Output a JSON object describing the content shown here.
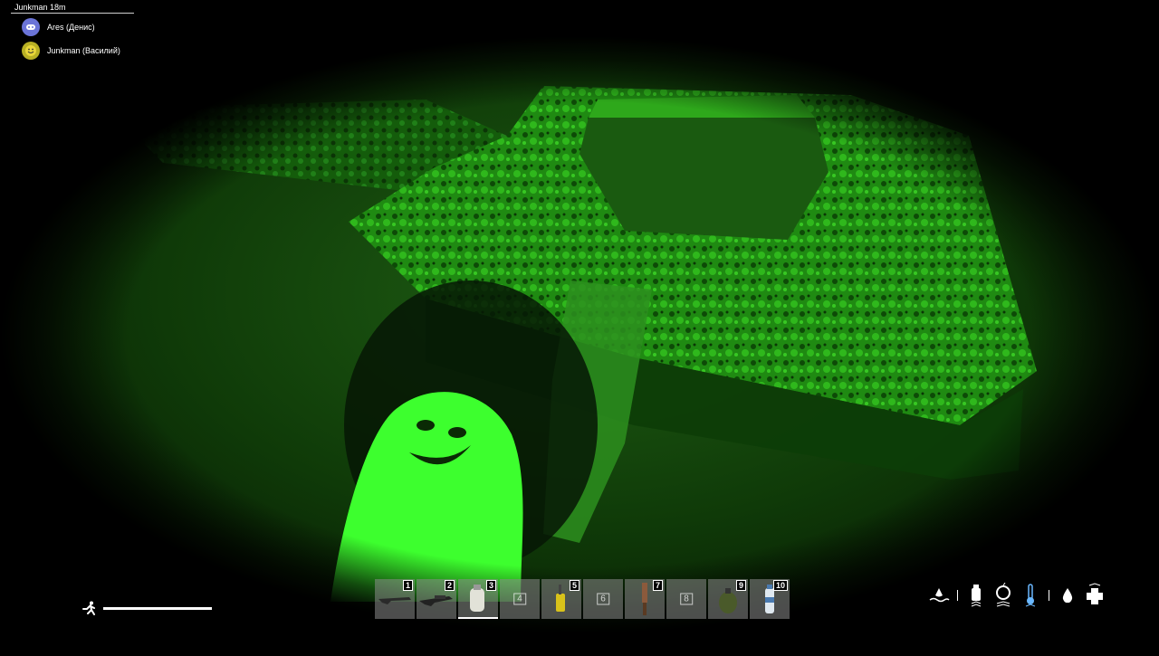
{
  "overlay": {
    "title": "Junkman 18m",
    "voice_users": [
      {
        "name": "Ares (Денис)",
        "avatar_icon": "discord-icon",
        "avatar_color": "#6b74d8"
      },
      {
        "name": "Junkman (Василий)",
        "avatar_icon": "smiley-icon",
        "avatar_color": "#8a8a2a"
      }
    ]
  },
  "hud": {
    "stamina_icon": "running-man-icon",
    "stamina_level": 1.0,
    "hotbar": [
      {
        "number": "1",
        "item": "rifle-icon",
        "has_item": true
      },
      {
        "number": "2",
        "item": "shotgun-icon",
        "has_item": true
      },
      {
        "number": "3",
        "item": "canteen-icon",
        "has_item": true,
        "selected": true
      },
      {
        "number": "4",
        "has_item": false
      },
      {
        "number": "5",
        "item": "lighter-icon",
        "has_item": true
      },
      {
        "number": "6",
        "has_item": false
      },
      {
        "number": "7",
        "item": "knife-icon",
        "has_item": true
      },
      {
        "number": "8",
        "has_item": false
      },
      {
        "number": "9",
        "item": "grenade-icon",
        "has_item": true
      },
      {
        "number": "10",
        "item": "water-bottle-icon",
        "has_item": true
      }
    ],
    "status_icons": [
      "wetness-icon",
      "bottle-thirst-icon",
      "apple-hunger-icon",
      "thermometer-icon",
      "blood-drop-icon",
      "health-cross-icon"
    ],
    "night_vision_color": "#2bff2b"
  }
}
